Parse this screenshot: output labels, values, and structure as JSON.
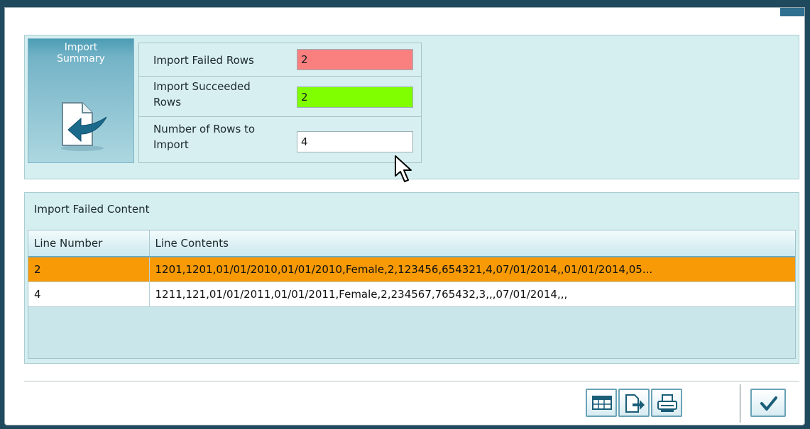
{
  "summary": {
    "title": "Import\nSummary",
    "failed_label": "Import Failed Rows",
    "failed_value": "2",
    "succeeded_label": "Import Succeeded Rows",
    "succeeded_value": "2",
    "total_label": "Number of Rows to Import",
    "total_value": "4",
    "colors": {
      "failed": "#fa8080",
      "succeeded": "#80ff00",
      "total": "#ffffff"
    }
  },
  "failed_content": {
    "title": "Import Failed Content",
    "columns": [
      "Line Number",
      "Line Contents"
    ],
    "rows": [
      {
        "line": "2",
        "contents": "1201,1201,01/01/2010,01/01/2010,Female,2,123456,654321,4,07/01/2014,,01/01/2014,05...",
        "selected": true
      },
      {
        "line": "4",
        "contents": "1211,121,01/01/2011,01/01/2011,Female,2,234567,765432,3,,,07/01/2014,,,",
        "selected": false
      }
    ]
  },
  "toolbar": {
    "buttons": [
      "grid-export-icon",
      "export-arrow-icon",
      "print-icon",
      "checkmark-icon"
    ]
  }
}
